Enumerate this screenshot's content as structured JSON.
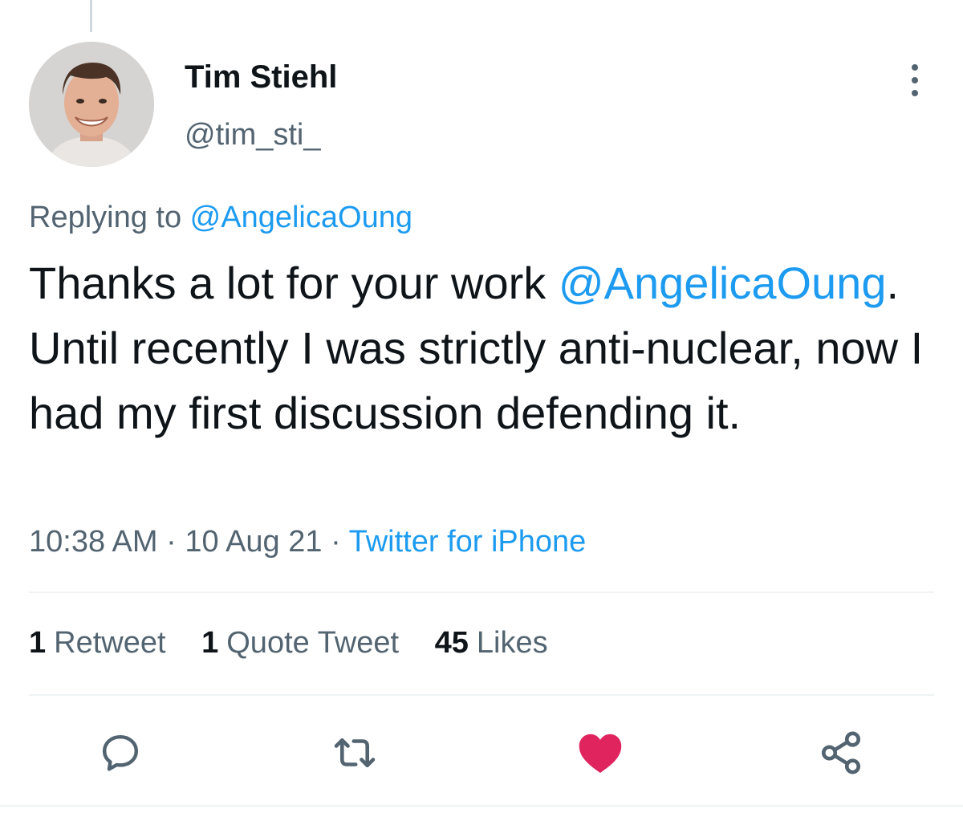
{
  "tweet": {
    "author": {
      "name": "Tim Stiehl",
      "handle": "@tim_sti_"
    },
    "reply_to": {
      "prefix": "Replying to ",
      "handle": "@AngelicaOung"
    },
    "text": {
      "part1": "Thanks a lot for your work ",
      "mention": "@AngelicaOung",
      "part2": ". Until recently I was strictly anti-nuclear, now I had my first discussion defending it."
    },
    "meta": {
      "time": "10:38 AM",
      "separator": " · ",
      "date": "10 Aug 21",
      "source": "Twitter for iPhone"
    },
    "stats": {
      "retweets": {
        "count": "1",
        "label": "Retweet"
      },
      "quotes": {
        "count": "1",
        "label": "Quote Tweet"
      },
      "likes": {
        "count": "45",
        "label": "Likes"
      }
    },
    "actions": {
      "reply": "reply-icon",
      "retweet": "retweet-icon",
      "like": "heart-icon",
      "share": "share-icon",
      "more": "more-vertical-icon"
    },
    "colors": {
      "link": "#1d9bf0",
      "secondary_text": "#536471",
      "primary_text": "#0f1419",
      "liked": "#e0245e"
    }
  }
}
